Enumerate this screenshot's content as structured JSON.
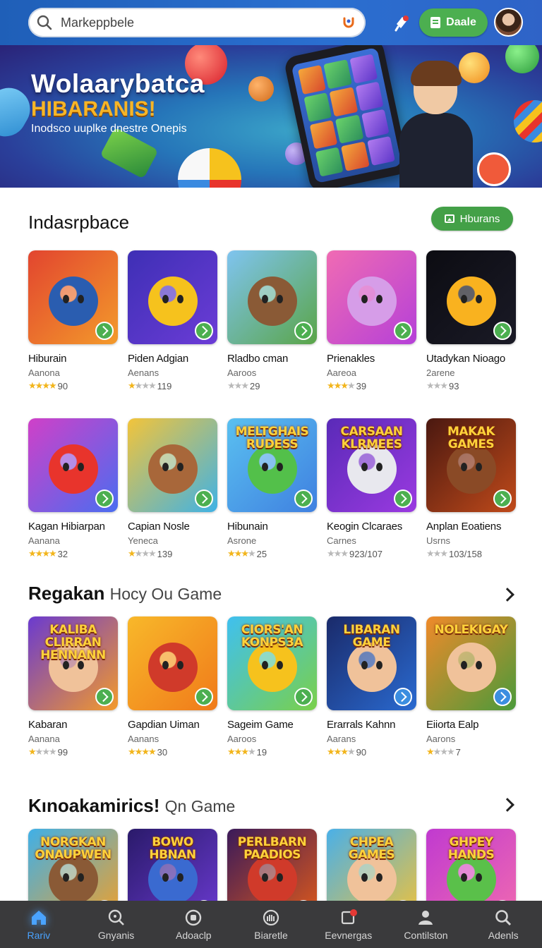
{
  "header": {
    "search_placeholder": "Markeppbele",
    "action_label": "Daale"
  },
  "banner": {
    "title": "Wolaarybatca",
    "subtitle": "HIBARANIS!",
    "description": "Inodsco uuplke dnestre Onepis"
  },
  "sections": [
    {
      "title": "Indasrpbace",
      "button_label": "Hburans",
      "rows": [
        [
          {
            "title": "Hiburain",
            "sub": "Aanona",
            "rating": "90",
            "stars": 4,
            "colors": [
              "#e2452f",
              "#f39a2b"
            ],
            "char": "#2a5db0",
            "label": ""
          },
          {
            "title": "Piden Adgian",
            "sub": "Aenans",
            "rating": "119",
            "stars": 1,
            "colors": [
              "#3e2fb5",
              "#6b3cd6"
            ],
            "char": "#f6c21d",
            "label": ""
          },
          {
            "title": "Rladbo cman",
            "sub": "Aaroos",
            "rating": "29",
            "stars": 0,
            "colors": [
              "#7fc4f0",
              "#5aa548"
            ],
            "char": "#8a5a36",
            "label": ""
          },
          {
            "title": "Prienakles",
            "sub": "Aareoa",
            "rating": "39",
            "stars": 3,
            "colors": [
              "#f06bb3",
              "#b540d8"
            ],
            "char": "#d69de8",
            "label": ""
          },
          {
            "title": "Utadykan Nioago",
            "sub": "2arene",
            "rating": "93",
            "stars": 0,
            "colors": [
              "#0c0c12",
              "#1a1a26"
            ],
            "char": "#f9b21f",
            "label": ""
          }
        ],
        [
          {
            "title": "Kagan Hibiarpan",
            "sub": "Aanana",
            "rating": "32",
            "stars": 4,
            "colors": [
              "#d040c8",
              "#4a6df0"
            ],
            "char": "#e8342c",
            "label": ""
          },
          {
            "title": "Capian Nosle",
            "sub": "Yeneca",
            "rating": "139",
            "stars": 1,
            "colors": [
              "#f3c43a",
              "#3fb2e5"
            ],
            "char": "#a8673a",
            "label": ""
          },
          {
            "title": "Hibunain",
            "sub": "Asrone",
            "rating": "25",
            "stars": 3,
            "colors": [
              "#5ac0f0",
              "#3f80e0"
            ],
            "char": "#53c04a",
            "label": "MELTGHAIS RUDESS"
          },
          {
            "title": "Keogin Clcaraes",
            "sub": "Carnes",
            "rating": "923/107",
            "stars": 0,
            "colors": [
              "#5a2ab8",
              "#9a3ae0"
            ],
            "char": "#e8e8ee",
            "label": "CARSAAN KLRMEES"
          },
          {
            "title": "Anplan Eoatiens",
            "sub": "Usrns",
            "rating": "103/158",
            "stars": 0,
            "colors": [
              "#4a1810",
              "#c04a1a"
            ],
            "char": "#8a4a26",
            "label": "MAKAK GAMES"
          }
        ]
      ]
    },
    {
      "title_bold": "Regakan",
      "title_light": "Hocy Ou Game",
      "rows": [
        [
          {
            "title": "Kabaran",
            "sub": "Aanana",
            "rating": "99",
            "stars": 1,
            "colors": [
              "#6a3ad0",
              "#f39a2b"
            ],
            "char": "#f0c29a",
            "label": "KALIBA CLIRRAN HENNANN"
          },
          {
            "title": "Gapdian Uiman",
            "sub": "Aanans",
            "rating": "30",
            "stars": 4,
            "colors": [
              "#f8b82a",
              "#f07a1a"
            ],
            "char": "#d03a2a",
            "label": ""
          },
          {
            "title": "Sageim Game",
            "sub": "Aaroos",
            "rating": "19",
            "stars": 3,
            "colors": [
              "#3fc0f0",
              "#7ad04a"
            ],
            "char": "#f6c21d",
            "label": "CIORS'AN KONPS3A"
          },
          {
            "title": "Erarrals Kahnn",
            "sub": "Aarans",
            "rating": "90",
            "stars": 3,
            "colors": [
              "#1a2a6a",
              "#2a6ad0"
            ],
            "char": "#f0c29a",
            "label": "LIBARAN GAME"
          },
          {
            "title": "Eiiorta Ealp",
            "sub": "Aarons",
            "rating": "7",
            "stars": 1,
            "colors": [
              "#f08a2a",
              "#4a9a3a"
            ],
            "char": "#f0c29a",
            "label": "NOLEKIGAY"
          }
        ]
      ]
    },
    {
      "title_bold": "Kınoakamirics!",
      "title_light": "Qn Game",
      "rows": [
        [
          {
            "title": "",
            "sub": "",
            "rating": "",
            "stars": 0,
            "colors": [
              "#3fb0e8",
              "#f0a02a"
            ],
            "char": "#8a5a36",
            "label": "NORGKAN ONAUPWEN"
          },
          {
            "title": "",
            "sub": "",
            "rating": "",
            "stars": 0,
            "colors": [
              "#2a1a6a",
              "#6a3ad0"
            ],
            "char": "#3a6ad0",
            "label": "BOWO HBNAN"
          },
          {
            "title": "",
            "sub": "",
            "rating": "",
            "stars": 0,
            "colors": [
              "#3a1a5a",
              "#e05a1a"
            ],
            "char": "#d03a2a",
            "label": "PERLBARN PAADIOS"
          },
          {
            "title": "",
            "sub": "",
            "rating": "",
            "stars": 0,
            "colors": [
              "#4ab0e8",
              "#f0c23a"
            ],
            "char": "#f0c29a",
            "label": "CHPEA GAMES"
          },
          {
            "title": "",
            "sub": "",
            "rating": "",
            "stars": 0,
            "colors": [
              "#c03ad0",
              "#f06ab0"
            ],
            "char": "#5ac04a",
            "label": "GHPEY HANDS"
          }
        ]
      ]
    }
  ],
  "bottom_nav": [
    {
      "label": "Rariv",
      "icon": "home-icon",
      "active": true
    },
    {
      "label": "Gnyanis",
      "icon": "search-gamepad-icon",
      "active": false
    },
    {
      "label": "Adoaclp",
      "icon": "compass-icon",
      "active": false
    },
    {
      "label": "Biaretle",
      "icon": "library-icon",
      "active": false
    },
    {
      "label": "Eevnergas",
      "icon": "updates-icon",
      "active": false
    },
    {
      "label": "Contilston",
      "icon": "profile-icon",
      "active": false
    },
    {
      "label": "Adenls",
      "icon": "search-icon",
      "active": false
    }
  ],
  "colors": {
    "accent_green": "#4caf50",
    "header_blue": "#2a6fd0",
    "nav_active": "#4aa3ff",
    "star": "#f2b51c"
  }
}
